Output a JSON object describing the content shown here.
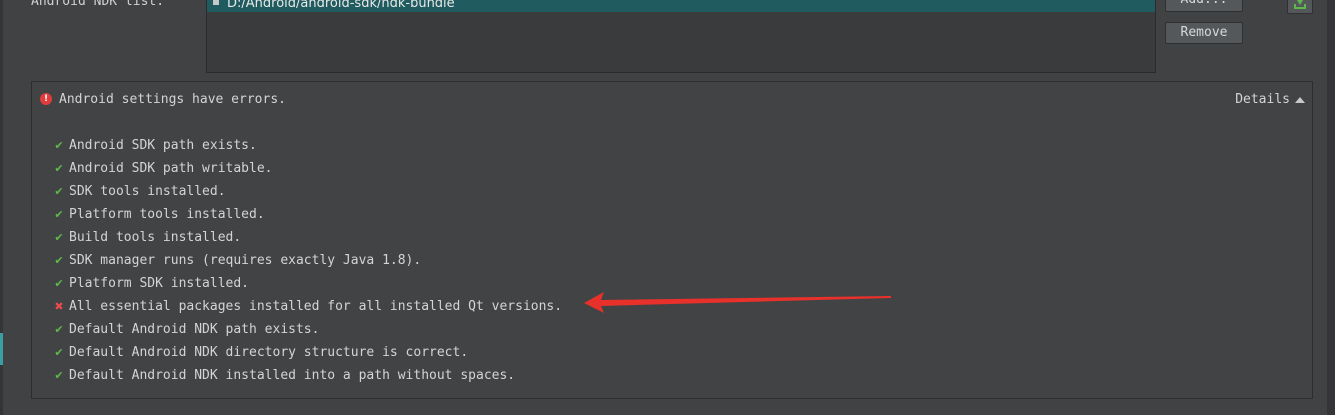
{
  "ndk": {
    "label": "Android NDK list:",
    "entries": [
      "D:/Android/android-sdk/ndk-bundle"
    ],
    "add_label": "Add...",
    "remove_label": "Remove",
    "download_icon": "download-icon"
  },
  "status_panel": {
    "title": "Android settings have errors.",
    "title_icon": "error-icon",
    "details_label": "Details",
    "details_icon": "caret-up-icon",
    "checks": [
      {
        "status": "ok",
        "text": "Android SDK path exists."
      },
      {
        "status": "ok",
        "text": "Android SDK path writable."
      },
      {
        "status": "ok",
        "text": "SDK tools installed."
      },
      {
        "status": "ok",
        "text": "Platform tools installed."
      },
      {
        "status": "ok",
        "text": "Build tools installed."
      },
      {
        "status": "ok",
        "text": "SDK manager runs (requires exactly Java 1.8)."
      },
      {
        "status": "ok",
        "text": "Platform SDK installed."
      },
      {
        "status": "fail",
        "text": "All essential packages installed for all installed Qt versions."
      },
      {
        "status": "ok",
        "text": "Default Android NDK path exists."
      },
      {
        "status": "ok",
        "text": "Default Android NDK directory structure is correct."
      },
      {
        "status": "ok",
        "text": "Default Android NDK installed into a path without spaces."
      }
    ]
  },
  "annotation": {
    "icon": "red-arrow-annotation",
    "color": "#e8312a"
  },
  "colors": {
    "background": "#404244",
    "selection": "#1f5b5f",
    "ok": "#5fb84a",
    "fail": "#e84c4c",
    "error_icon": "#e23b3b"
  }
}
